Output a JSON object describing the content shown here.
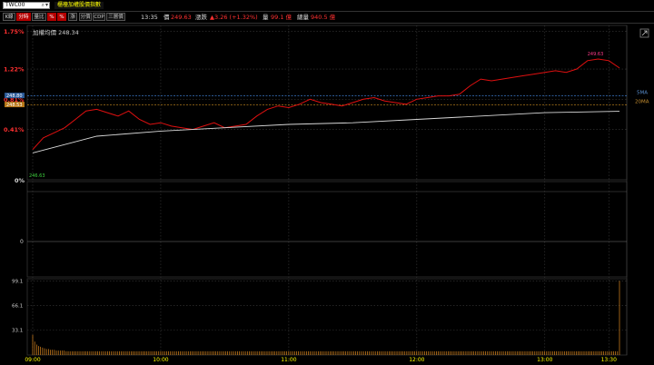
{
  "header": {
    "symbol": "TWC00",
    "title": "櫃檯加權股價指數"
  },
  "toolbar": {
    "buttons": [
      "K線",
      "分時",
      "量比",
      "%",
      "%",
      "漲",
      "分價",
      "CDP",
      "三層價"
    ],
    "time": "13:35",
    "price_label": "價",
    "price": "249.63",
    "change_label": "漲跌",
    "change": "▲3.26 (+1.32%)",
    "volume_label": "量",
    "volume": "99.1 億",
    "total_volume_label": "總量",
    "total_volume": "940.5 億"
  },
  "chart_data": {
    "type": "line",
    "title": "",
    "annotation_avg": "加權均價 248.34",
    "price_pane": {
      "y_tick_labels": [
        "1.75%",
        "1.22%",
        "0.81%",
        "0.41%"
      ],
      "y_tick_values": [
        250.73,
        249.6,
        248.7,
        247.8
      ],
      "ylim": [
        246.3,
        250.9
      ],
      "last_label": "249.63",
      "ref_label": "246.63",
      "sma_label": "5MA",
      "sma_value": 248.8,
      "ma20_label": "20MA",
      "ma20_value": 248.53,
      "line_labels": [
        "248.80",
        "248.53"
      ],
      "series": [
        {
          "name": "價",
          "color": "#e01010",
          "x": [
            "09:00",
            "09:05",
            "09:10",
            "09:15",
            "09:20",
            "09:25",
            "09:30",
            "09:35",
            "09:40",
            "09:45",
            "09:50",
            "09:55",
            "10:00",
            "10:05",
            "10:10",
            "10:15",
            "10:20",
            "10:25",
            "10:30",
            "10:35",
            "10:40",
            "10:45",
            "10:50",
            "10:55",
            "11:00",
            "11:05",
            "11:10",
            "11:15",
            "11:20",
            "11:25",
            "11:30",
            "11:35",
            "11:40",
            "11:45",
            "11:50",
            "11:55",
            "12:00",
            "12:05",
            "12:10",
            "12:15",
            "12:20",
            "12:25",
            "12:30",
            "12:35",
            "12:40",
            "12:45",
            "12:50",
            "12:55",
            "13:00",
            "13:05",
            "13:10",
            "13:15",
            "13:20",
            "13:25",
            "13:30",
            "13:35"
          ],
          "values": [
            247.2,
            247.55,
            247.7,
            247.85,
            248.1,
            248.35,
            248.4,
            248.3,
            248.2,
            248.35,
            248.1,
            247.95,
            248.0,
            247.9,
            247.85,
            247.8,
            247.9,
            248.0,
            247.85,
            247.9,
            247.95,
            248.2,
            248.4,
            248.5,
            248.45,
            248.55,
            248.7,
            248.6,
            248.55,
            248.5,
            248.6,
            248.7,
            248.75,
            248.65,
            248.6,
            248.55,
            248.7,
            248.75,
            248.8,
            248.8,
            248.85,
            249.1,
            249.3,
            249.25,
            249.3,
            249.35,
            249.4,
            249.45,
            249.5,
            249.55,
            249.5,
            249.6,
            249.85,
            249.9,
            249.85,
            249.63
          ]
        },
        {
          "name": "均價",
          "color": "#d8d8d8",
          "x": [
            "09:00",
            "09:30",
            "10:00",
            "10:30",
            "11:00",
            "11:30",
            "12:00",
            "12:30",
            "13:00",
            "13:35"
          ],
          "values": [
            247.1,
            247.6,
            247.75,
            247.85,
            247.95,
            248.0,
            248.1,
            248.2,
            248.3,
            248.34
          ]
        }
      ]
    },
    "mid_pane": {
      "labels": [
        "0%",
        "0"
      ]
    },
    "volume_pane": {
      "y_tick_labels": [
        "99.1",
        "66.1",
        "33.1"
      ],
      "y_tick_values": [
        99.1,
        66.1,
        33.1
      ],
      "ylim": [
        0,
        102
      ],
      "color": "#e08a20",
      "values": [
        27,
        18,
        14,
        12,
        11,
        10,
        9,
        8,
        8,
        7,
        7,
        7,
        6,
        6,
        6,
        6,
        6,
        5,
        5,
        5,
        5,
        5,
        5,
        5,
        5,
        5,
        5,
        5,
        5,
        5,
        5,
        5,
        5,
        5,
        5,
        5,
        5,
        5,
        5,
        5,
        5,
        5,
        5,
        5,
        5,
        5,
        5,
        5,
        5,
        5,
        5,
        5,
        5,
        5,
        5,
        5,
        5,
        5,
        5,
        5,
        5,
        5,
        5,
        5,
        5,
        5,
        5,
        5,
        5,
        5,
        5,
        5,
        5,
        5,
        5,
        5,
        5,
        5,
        5,
        5,
        5,
        5,
        5,
        5,
        5,
        5,
        5,
        5,
        5,
        5,
        5,
        5,
        5,
        5,
        5,
        5,
        5,
        5,
        5,
        5,
        5,
        5,
        5,
        5,
        5,
        5,
        5,
        5,
        5,
        5,
        5,
        5,
        5,
        5,
        5,
        5,
        5,
        5,
        5,
        5,
        5,
        5,
        5,
        5,
        5,
        5,
        5,
        5,
        5,
        5,
        5,
        5,
        5,
        5,
        5,
        5,
        5,
        5,
        5,
        5,
        5,
        5,
        5,
        5,
        5,
        5,
        5,
        5,
        5,
        5,
        5,
        5,
        5,
        5,
        5,
        5,
        5,
        5,
        5,
        5,
        5,
        5,
        5,
        5,
        5,
        5,
        5,
        5,
        5,
        5,
        5,
        5,
        5,
        5,
        5,
        5,
        5,
        5,
        5,
        5,
        5,
        5,
        5,
        5,
        5,
        5,
        5,
        5,
        5,
        5,
        5,
        5,
        5,
        5,
        5,
        5,
        5,
        5,
        5,
        5,
        5,
        5,
        5,
        5,
        5,
        5,
        5,
        5,
        5,
        5,
        5,
        5,
        5,
        5,
        5,
        5,
        5,
        5,
        5,
        5,
        5,
        5,
        5,
        5,
        5,
        5,
        5,
        5,
        5,
        5,
        5,
        5,
        5,
        5,
        5,
        5,
        5,
        5,
        5,
        5,
        5,
        5,
        5,
        5,
        5,
        5,
        5,
        5,
        5,
        5,
        5,
        5,
        5,
        5,
        5,
        5,
        5,
        5,
        5,
        5,
        5,
        5,
        5,
        5,
        5,
        5,
        5,
        5,
        5,
        5,
        5,
        5,
        5,
        5,
        5,
        5,
        5,
        5,
        5,
        5,
        5,
        5,
        5,
        5,
        5,
        5,
        5,
        5,
        5,
        5,
        5,
        5,
        5,
        5,
        5,
        5,
        5,
        5,
        99.1
      ]
    },
    "x_tick_labels": [
      "09:00",
      "10:00",
      "11:00",
      "12:00",
      "13:00",
      "13:30"
    ],
    "x_tick_values": [
      "09:00",
      "10:00",
      "11:00",
      "12:00",
      "13:00",
      "13:30"
    ],
    "xlim": [
      "09:00",
      "13:35"
    ],
    "grid": true
  }
}
